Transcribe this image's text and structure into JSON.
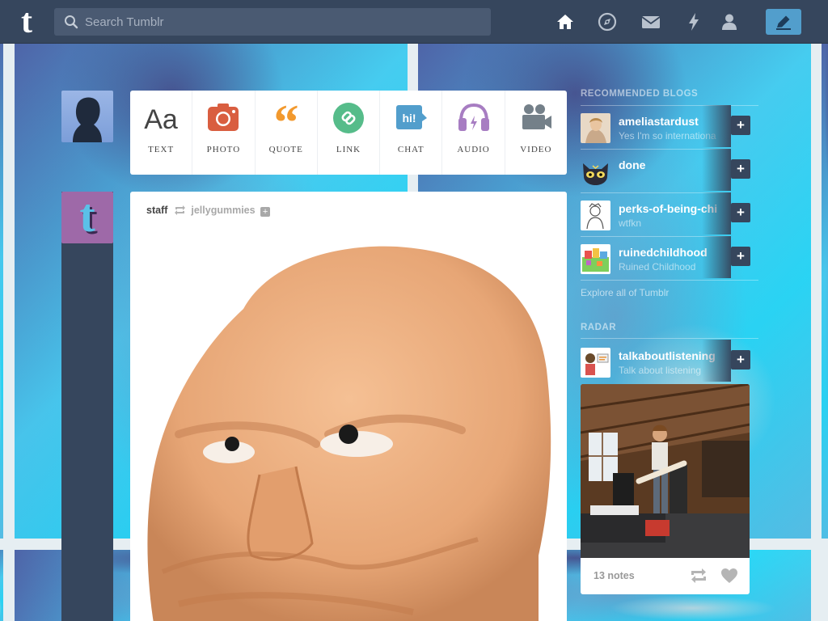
{
  "app": {
    "logo": "t"
  },
  "search": {
    "placeholder": "Search Tumblr"
  },
  "nav": {
    "icons": [
      "home-icon",
      "explore-icon",
      "inbox-icon",
      "activity-icon",
      "account-icon"
    ],
    "compose_icon": "pencil-icon"
  },
  "post_types": [
    {
      "label": "TEXT",
      "icon": "text-icon",
      "color": "#444444"
    },
    {
      "label": "PHOTO",
      "icon": "photo-icon",
      "color": "#d95e40"
    },
    {
      "label": "QUOTE",
      "icon": "quote-icon",
      "color": "#f2992e"
    },
    {
      "label": "LINK",
      "icon": "link-icon",
      "color": "#56bc8a"
    },
    {
      "label": "CHAT",
      "icon": "chat-icon",
      "color": "#529ecc"
    },
    {
      "label": "AUDIO",
      "icon": "audio-icon",
      "color": "#a77dc2"
    },
    {
      "label": "VIDEO",
      "icon": "video-icon",
      "color": "#748089"
    }
  ],
  "post": {
    "author": "staff",
    "reblogged_from": "jellygummies",
    "follow_glyph": "+"
  },
  "sidebar": {
    "recommended_title": "RECOMMENDED BLOGS",
    "blogs": [
      {
        "name": "ameliastardust",
        "sub": "Yes I'm so internationa"
      },
      {
        "name": "done",
        "sub": ""
      },
      {
        "name": "perks-of-being-chi",
        "sub": "wtfkn"
      },
      {
        "name": "ruinedchildhood",
        "sub": "Ruined Childhood"
      }
    ],
    "explore": "Explore all of Tumblr",
    "radar_title": "RADAR",
    "radar_blog": {
      "name": "talkaboutlistening",
      "sub": "Talk about listening"
    },
    "radar_notes": "13 notes",
    "plus_glyph": "+"
  },
  "colors": {
    "nav_bg": "#36465d",
    "compose": "#529ecc",
    "background": "#29d8f6"
  }
}
